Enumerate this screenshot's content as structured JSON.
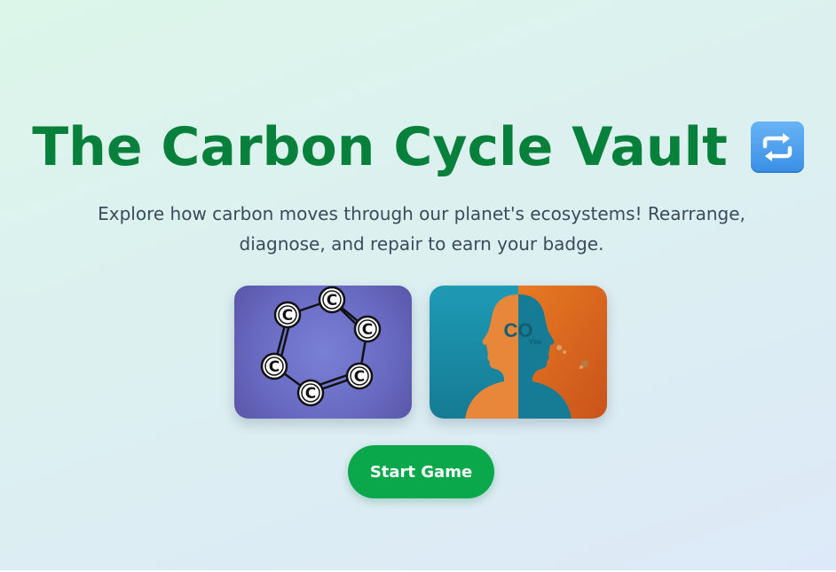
{
  "header": {
    "title": "The Carbon Cycle Vault",
    "title_icon": "repeat-arrows-icon"
  },
  "intro": {
    "text": "Explore how carbon moves through our planet's ecosystems! Rearrange, diagnose, and repair to earn your badge."
  },
  "images": {
    "molecule": {
      "icon": "carbon-ring-molecule",
      "atom_label": "C"
    },
    "co2_people": {
      "icon": "co2-faces-illustration",
      "label_co": "CO",
      "label_you": "You"
    }
  },
  "actions": {
    "start_label": "Start Game"
  },
  "colors": {
    "title": "#06803a",
    "button": "#0aa84b",
    "text": "#3c4a5c"
  }
}
